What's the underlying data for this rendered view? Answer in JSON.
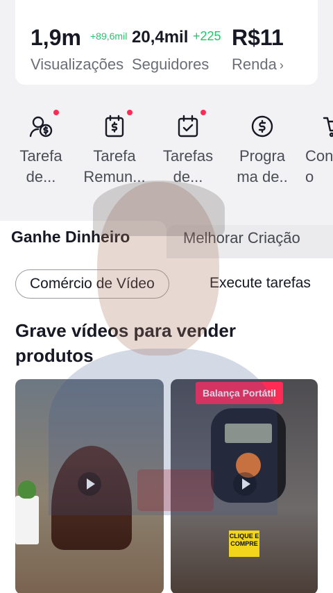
{
  "stats": {
    "views": {
      "value": "1,9m",
      "delta": "+89,6mil",
      "label": "Visualizações"
    },
    "followers": {
      "value": "20,4mil",
      "delta": "+225",
      "label": "Seguidores"
    },
    "income": {
      "value": "R$11",
      "label": "Renda",
      "chevron": "›"
    }
  },
  "tools": [
    {
      "label": "Tarefa\nde...",
      "icon": "user-dollar-icon",
      "has_dot": true
    },
    {
      "label": "Tarefa\nRemun...",
      "icon": "dollar-document-icon",
      "has_dot": true
    },
    {
      "label": "Tarefas\nde...",
      "icon": "calendar-check-icon",
      "has_dot": true
    },
    {
      "label": "Progra\nma de..",
      "icon": "dollar-circle-icon",
      "has_dot": false
    },
    {
      "label": "Con\no",
      "icon": "cart-icon",
      "has_dot": false
    }
  ],
  "tabs": {
    "active": "Ganhe Dinheiro",
    "inactive": "Melhorar Criação"
  },
  "chips": {
    "selected": "Comércio de Vídeo",
    "other": "Execute tarefas"
  },
  "section": {
    "title": "Grave vídeos para vender produtos"
  },
  "thumbnails": {
    "right": {
      "promo_label": "Balança Portátil",
      "buy_label": "CLIQUE E COMPRE"
    }
  },
  "colors": {
    "accent": "#fe2c55",
    "positive": "#20c76a"
  }
}
